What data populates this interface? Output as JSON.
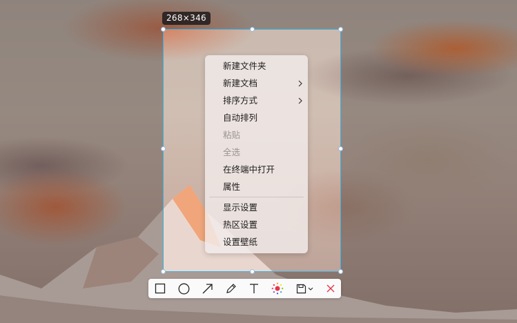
{
  "screenshot_tool": {
    "size_label": "268×346",
    "toolbar": {
      "tools": [
        {
          "name": "rectangle-tool",
          "icon": "square-icon"
        },
        {
          "name": "ellipse-tool",
          "icon": "circle-icon"
        },
        {
          "name": "arrow-tool",
          "icon": "arrow-icon"
        },
        {
          "name": "pen-tool",
          "icon": "pencil-icon"
        },
        {
          "name": "text-tool",
          "icon": "text-icon"
        },
        {
          "name": "color-tool",
          "icon": "color-picker-icon"
        },
        {
          "name": "save-tool",
          "icon": "save-icon"
        },
        {
          "name": "close-tool",
          "icon": "close-icon"
        }
      ],
      "accent_color": "#3ab0e6",
      "close_color": "#e0394a",
      "selected_color": "#e8354a"
    }
  },
  "context_menu": {
    "items": [
      {
        "label": "新建文件夹",
        "submenu": false,
        "disabled": false
      },
      {
        "label": "新建文档",
        "submenu": true,
        "disabled": false
      },
      {
        "label": "排序方式",
        "submenu": true,
        "disabled": false
      },
      {
        "label": "自动排列",
        "submenu": false,
        "disabled": false
      },
      {
        "label": "粘贴",
        "submenu": false,
        "disabled": true
      },
      {
        "label": "全选",
        "submenu": false,
        "disabled": true
      },
      {
        "label": "在终端中打开",
        "submenu": false,
        "disabled": false
      },
      {
        "label": "属性",
        "submenu": false,
        "disabled": false
      },
      {
        "label": "显示设置",
        "submenu": false,
        "disabled": false
      },
      {
        "label": "热区设置",
        "submenu": false,
        "disabled": false
      },
      {
        "label": "设置壁纸",
        "submenu": false,
        "disabled": false
      }
    ]
  }
}
